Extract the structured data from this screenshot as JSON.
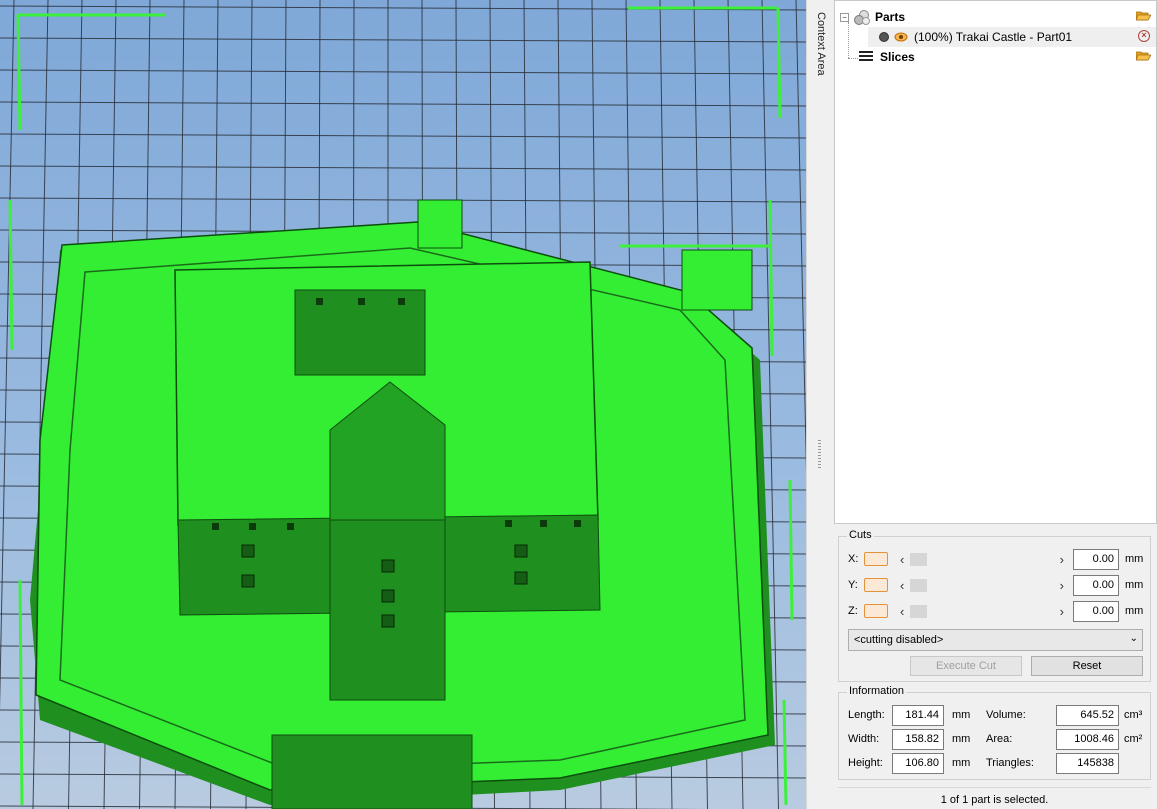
{
  "context_area": {
    "label": "Context Area"
  },
  "tree": {
    "parts_label": "Parts",
    "part_item_label": "(100%) Trakai Castle - Part01",
    "slices_label": "Slices",
    "collapse_symbol": "−"
  },
  "cuts": {
    "title": "Cuts",
    "axes": [
      {
        "label": "X:",
        "value": "0.00",
        "unit": "mm"
      },
      {
        "label": "Y:",
        "value": "0.00",
        "unit": "mm"
      },
      {
        "label": "Z:",
        "value": "0.00",
        "unit": "mm"
      }
    ],
    "mode_selected": "<cutting disabled>",
    "execute_label": "Execute Cut",
    "reset_label": "Reset"
  },
  "information": {
    "title": "Information",
    "length_label": "Length:",
    "length_value": "181.44",
    "length_unit": "mm",
    "width_label": "Width:",
    "width_value": "158.82",
    "width_unit": "mm",
    "height_label": "Height:",
    "height_value": "106.80",
    "height_unit": "mm",
    "volume_label": "Volume:",
    "volume_value": "645.52",
    "volume_unit": "cm³",
    "area_label": "Area:",
    "area_value": "1008.46",
    "area_unit": "cm²",
    "triangles_label": "Triangles:",
    "triangles_value": "145838"
  },
  "status": {
    "text": "1 of 1 part is selected."
  },
  "colors": {
    "model_green": "#33ee33",
    "model_dark": "#1f8f1f",
    "accent_orange": "#e3913b",
    "grid_bg": "#8fb3dd"
  },
  "icons": [
    "folder-open-icon",
    "spheres-icon",
    "eye-icon",
    "delete-icon",
    "layers-icon",
    "chevron-down-icon"
  ]
}
